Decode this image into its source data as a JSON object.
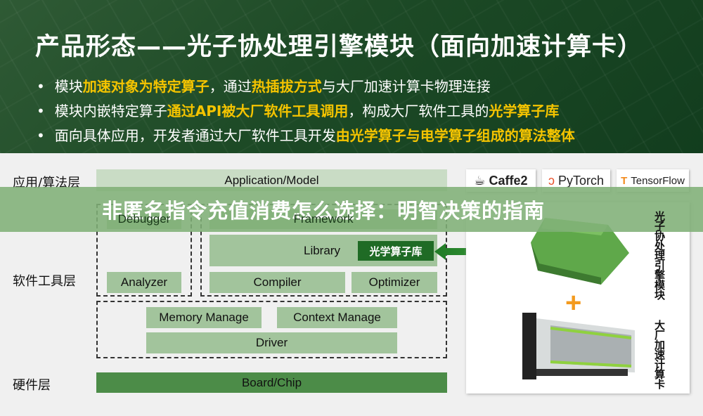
{
  "slide": {
    "title": "产品形态——光子协处理引擎模块（面向加速计算卡）",
    "bullets": [
      [
        {
          "t": "模块",
          "h": false
        },
        {
          "t": "加速对象为特定算子",
          "h": true
        },
        {
          "t": "，通过",
          "h": false
        },
        {
          "t": "热插拔方式",
          "h": true
        },
        {
          "t": "与大厂加速计算卡物理连接",
          "h": false
        }
      ],
      [
        {
          "t": "模块内嵌特定算子",
          "h": false
        },
        {
          "t": "通过API被大厂软件工具调用",
          "h": true
        },
        {
          "t": "，构成大厂软件工具的",
          "h": false
        },
        {
          "t": "光学算子库",
          "h": true
        }
      ],
      [
        {
          "t": "面向具体应用，开发者通过大厂软件工具开发",
          "h": false
        },
        {
          "t": "由光学算子与电学算子组成的算法整体",
          "h": true
        }
      ]
    ],
    "highlight_color": "#f5c400"
  },
  "layers": {
    "app": "应用/算法层",
    "software": "软件工具层",
    "hardware": "硬件层"
  },
  "stack": {
    "application": "Application/Model",
    "debugger": "Debugger",
    "framework": "Framework",
    "library": "Library",
    "optical_lib": "光学算子库",
    "analyzer": "Analyzer",
    "compiler": "Compiler",
    "optimizer": "Optimizer",
    "memory": "Memory Manage",
    "context": "Context Manage",
    "driver": "Driver",
    "board": "Board/Chip"
  },
  "logos": [
    "Caffe2",
    "PyTorch",
    "TensorFlow"
  ],
  "products": {
    "module": "光子协处理引擎模块",
    "card": "大厂加速计算卡"
  },
  "banner": {
    "text": "非匿名指令充值消费怎么选择：明智决策的指南"
  }
}
